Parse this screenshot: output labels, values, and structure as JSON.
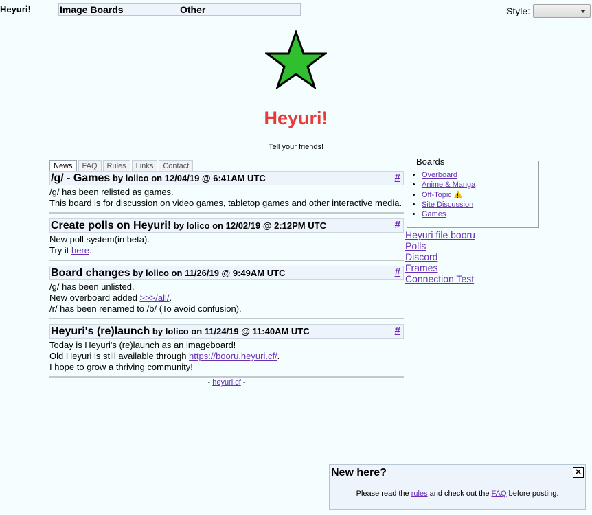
{
  "header": {
    "site_name": "Heyuri!",
    "nav": [
      "Image Boards",
      "Other"
    ],
    "style_label": "Style:",
    "style_value": ""
  },
  "hero": {
    "title": "Heyuri!",
    "tagline": "Tell your friends!",
    "logo_icon": "green-star-icon",
    "title_color": "#e53b3b",
    "star_color": "#2fbf2f"
  },
  "tabs": [
    "News",
    "FAQ",
    "Rules",
    "Links",
    "Contact"
  ],
  "posts": [
    {
      "title": "/g/ - Games",
      "byline": "by lolico on 12/04/19 @ 6:41AM UTC",
      "anchor": "#",
      "lines": [
        {
          "text": "/g/ has been relisted as games."
        },
        {
          "text": "This board is for discussion on video games, tabletop games and other interactive media."
        }
      ]
    },
    {
      "title": "Create polls on Heyuri!",
      "byline": "by lolico on 12/02/19 @ 2:12PM UTC",
      "anchor": "#",
      "lines": [
        {
          "text": "New poll system(in beta)."
        },
        {
          "pre": "Try it ",
          "link": "here",
          "post": "."
        }
      ]
    },
    {
      "title": "Board changes",
      "byline": "by lolico on 11/26/19 @ 9:49AM UTC",
      "anchor": "#",
      "lines": [
        {
          "text": "/g/ has been unlisted."
        },
        {
          "pre": "New overboard added ",
          "link": ">>>/all/",
          "post": "."
        },
        {
          "text": "/r/ has been renamed to /b/ (To avoid confusion)."
        }
      ]
    },
    {
      "title": "Heyuri's (re)launch",
      "byline": "by lolico on 11/24/19 @ 11:40AM UTC",
      "anchor": "#",
      "lines": [
        {
          "text": "Today is Heyuri's (re)launch as an imageboard!"
        },
        {
          "pre": "Old Heyuri is still available through ",
          "link": "https://booru.heyuri.cf/",
          "post": "."
        },
        {
          "text": "I hope to grow a thriving community!"
        }
      ]
    }
  ],
  "footer": {
    "pre": "- ",
    "link": "heyuri.cf",
    "post": " -"
  },
  "boards_box": {
    "legend": "Boards",
    "items": [
      "Overboard",
      "Anime & Manga",
      "Off-Topic",
      "Site Discussion",
      "Games"
    ],
    "warning_item": "Off-Topic"
  },
  "side_links": [
    "Heyuri file booru",
    "Polls",
    "Discord",
    "Frames",
    "Connection Test"
  ],
  "new_here": {
    "title": "New here?",
    "close_label": "×",
    "text_pre": "Please read the ",
    "link1": "rules",
    "text_mid": " and check out the ",
    "link2": "FAQ",
    "text_post": " before posting."
  }
}
